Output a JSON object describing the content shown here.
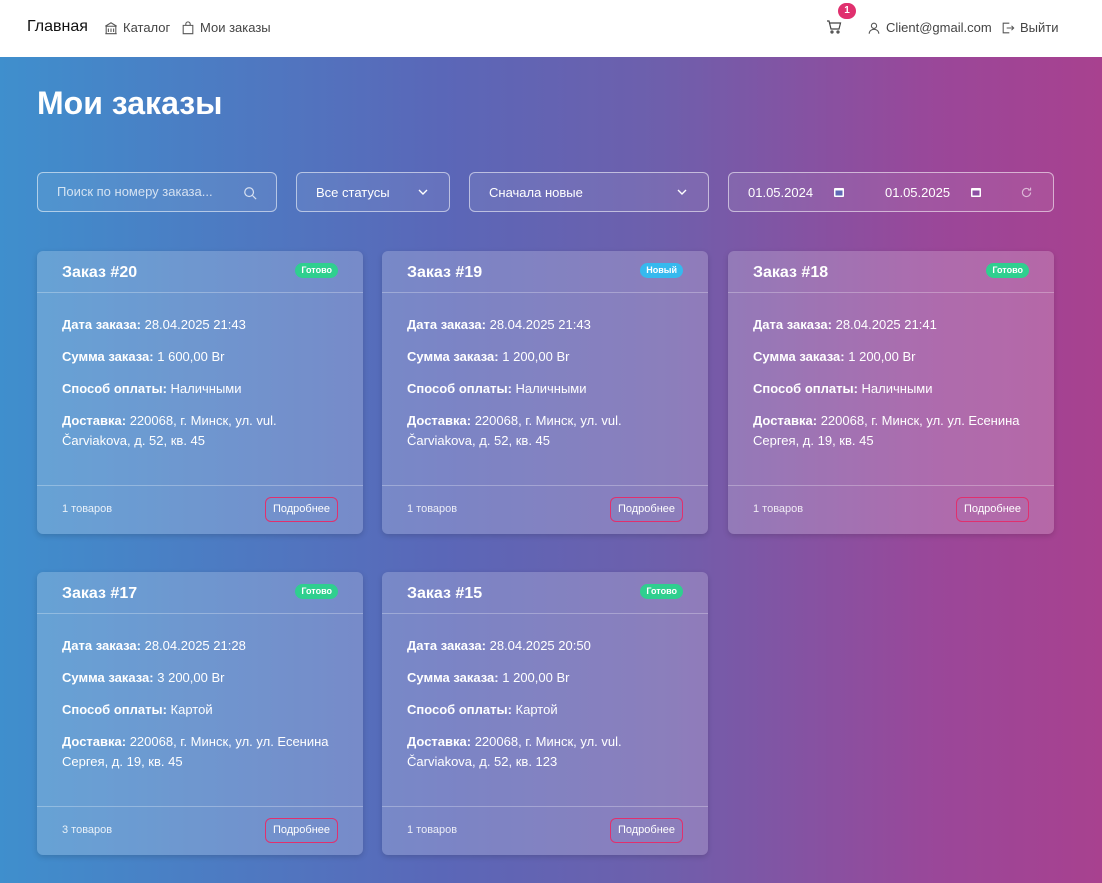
{
  "nav": {
    "brand": "Главная",
    "catalog": "Каталог",
    "orders": "Мои заказы",
    "cart_count": "1",
    "user_email": "Client@gmail.com",
    "logout": "Выйти"
  },
  "page": {
    "title": "Мои заказы"
  },
  "filters": {
    "search_placeholder": "Поиск по номеру заказа...",
    "status_value": "Все статусы",
    "sort_value": "Сначала новые",
    "date_from": "01.05.2024",
    "date_to": "01.05.2025"
  },
  "labels": {
    "date": "Дата заказа:",
    "sum": "Сумма заказа:",
    "payment": "Способ оплаты:",
    "delivery": "Доставка:",
    "details_button": "Подробнее"
  },
  "orders": [
    {
      "title": "Заказ #20",
      "status": "Готово",
      "date": "28.04.2025 21:43",
      "sum": "1 600,00 Br",
      "payment": "Наличными",
      "delivery": "220068, г. Минск, ул. vul. Čarviakova, д. 52, кв. 45",
      "items": "1 товаров"
    },
    {
      "title": "Заказ #19",
      "status": "Новый",
      "date": "28.04.2025 21:43",
      "sum": "1 200,00 Br",
      "payment": "Наличными",
      "delivery": "220068, г. Минск, ул. vul. Čarviakova, д. 52, кв. 45",
      "items": "1 товаров"
    },
    {
      "title": "Заказ #18",
      "status": "Готово",
      "date": "28.04.2025 21:41",
      "sum": "1 200,00 Br",
      "payment": "Наличными",
      "delivery": "220068, г. Минск, ул. ул. Есенина Сергея, д. 19, кв. 45",
      "items": "1 товаров"
    },
    {
      "title": "Заказ #17",
      "status": "Готово",
      "date": "28.04.2025 21:28",
      "sum": "3 200,00 Br",
      "payment": "Картой",
      "delivery": "220068, г. Минск, ул. ул. Есенина Сергея, д. 19, кв. 45",
      "items": "3 товаров"
    },
    {
      "title": "Заказ #15",
      "status": "Готово",
      "date": "28.04.2025 20:50",
      "sum": "1 200,00 Br",
      "payment": "Картой",
      "delivery": "220068, г. Минск, ул. vul. Čarviakova, д. 52, кв. 123",
      "items": "1 товаров"
    }
  ],
  "colors": {
    "accent": "#e0306e",
    "status_done": "#2fcf8f",
    "status_new": "#36b9ee"
  }
}
